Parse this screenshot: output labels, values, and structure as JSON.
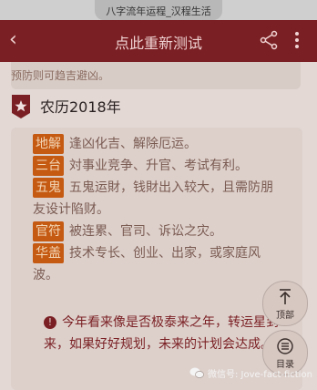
{
  "status": {
    "title": "八字流年运程_汉程生活"
  },
  "header": {
    "back": "‹",
    "title": "点此重新测试"
  },
  "prev": {
    "text": "预防则可趋吉避凶。"
  },
  "section": {
    "title": "农历2018年"
  },
  "entries": [
    {
      "tag": "地解",
      "text": "逢凶化吉、解除厄运。"
    },
    {
      "tag": "三台",
      "text": "対事业竞争、升官、考试有利。"
    },
    {
      "tag": "五鬼",
      "text": "五鬼运財，钱財出入较大，且需防朋友设计陷财。"
    },
    {
      "tag": "官符",
      "text": "被连累、官司、诉讼之灾。"
    },
    {
      "tag": "华盖",
      "text": "技术专长、创业、出家，或家庭风波。"
    }
  ],
  "warning": {
    "icon": "!",
    "text": "今年看来像是否极泰来之年，转运星到来，如果好好规划，未来的计划会达成。"
  },
  "fab_top": {
    "label": "顶部"
  },
  "fab_toc": {
    "label": "目录"
  },
  "watermark": {
    "text": "微信号: Jove-fact-fiction"
  },
  "colors": {
    "header": "#7a1f23",
    "tag": "#c55a12",
    "warning": "#7a1f23"
  }
}
